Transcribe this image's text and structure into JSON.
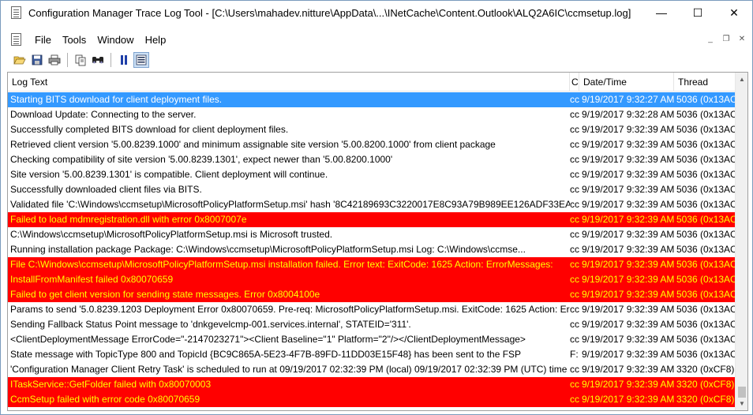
{
  "window": {
    "title": "Configuration Manager Trace Log Tool - [C:\\Users\\mahadev.nitture\\AppData\\...\\INetCache\\Content.Outlook\\ALQ2A6IC\\ccmsetup.log]",
    "minimize": "—",
    "maximize": "☐",
    "close": "✕"
  },
  "menu": {
    "items": [
      "File",
      "Tools",
      "Window",
      "Help"
    ],
    "mdi_minimize": "_",
    "mdi_restore": "❐",
    "mdi_close": "✕"
  },
  "toolbar": {
    "icons": [
      "open-folder-icon",
      "save-icon",
      "print-icon",
      "copy-icon",
      "find-icon",
      "pause-icon",
      "highlight-icon"
    ]
  },
  "columns": {
    "log_text": "Log Text",
    "component": "C",
    "date_time": "Date/Time",
    "thread": "Thread"
  },
  "colors": {
    "selected_bg": "#3399ff",
    "error_bg": "#ff0000",
    "error_text": "#ffff00"
  },
  "rows": [
    {
      "text": "Starting BITS download for client deployment files.",
      "comp": "cc",
      "date": "9/19/2017 9:32:27 AM",
      "thread": "5036 (0x13AC)",
      "type": "selected"
    },
    {
      "text": "Download Update: Connecting to the server.",
      "comp": "cc",
      "date": "9/19/2017 9:32:28 AM",
      "thread": "5036 (0x13AC)",
      "type": "normal"
    },
    {
      "text": "Successfully completed BITS download for client deployment files.",
      "comp": "cc",
      "date": "9/19/2017 9:32:39 AM",
      "thread": "5036 (0x13AC)",
      "type": "normal"
    },
    {
      "text": "Retrieved client version '5.00.8239.1000' and minimum assignable site version '5.00.8200.1000' from client package",
      "comp": "cc",
      "date": "9/19/2017 9:32:39 AM",
      "thread": "5036 (0x13AC)",
      "type": "normal"
    },
    {
      "text": "Checking compatibility of site version '5.00.8239.1301', expect newer than '5.00.8200.1000'",
      "comp": "cc",
      "date": "9/19/2017 9:32:39 AM",
      "thread": "5036 (0x13AC)",
      "type": "normal"
    },
    {
      "text": "Site version '5.00.8239.1301' is compatible. Client deployment will continue.",
      "comp": "cc",
      "date": "9/19/2017 9:32:39 AM",
      "thread": "5036 (0x13AC)",
      "type": "normal"
    },
    {
      "text": "Successfully downloaded client files via BITS.",
      "comp": "cc",
      "date": "9/19/2017 9:32:39 AM",
      "thread": "5036 (0x13AC)",
      "type": "normal"
    },
    {
      "text": "Validated file 'C:\\Windows\\ccmsetup\\MicrosoftPolicyPlatformSetup.msi' hash '8C42189693C3220017E8C93A79B989EE126ADF33EAD...",
      "comp": "cc",
      "date": "9/19/2017 9:32:39 AM",
      "thread": "5036 (0x13AC)",
      "type": "normal"
    },
    {
      "text": "Failed to load mdmregistration.dll with error 0x8007007e",
      "comp": "cc",
      "date": "9/19/2017 9:32:39 AM",
      "thread": "5036 (0x13AC)",
      "type": "error"
    },
    {
      "text": "C:\\Windows\\ccmsetup\\MicrosoftPolicyPlatformSetup.msi is Microsoft trusted.",
      "comp": "cc",
      "date": "9/19/2017 9:32:39 AM",
      "thread": "5036 (0x13AC)",
      "type": "normal"
    },
    {
      "text": "Running installation package   Package:     C:\\Windows\\ccmsetup\\MicrosoftPolicyPlatformSetup.msi   Log:        C:\\Windows\\ccmse...",
      "comp": "cc",
      "date": "9/19/2017 9:32:39 AM",
      "thread": "5036 (0x13AC)",
      "type": "normal"
    },
    {
      "text": "File C:\\Windows\\ccmsetup\\MicrosoftPolicyPlatformSetup.msi installation failed. Error text: ExitCode: 1625 Action: ErrorMessages:",
      "comp": "cc",
      "date": "9/19/2017 9:32:39 AM",
      "thread": "5036 (0x13AC)",
      "type": "error"
    },
    {
      "text": "InstallFromManifest failed 0x80070659",
      "comp": "cc",
      "date": "9/19/2017 9:32:39 AM",
      "thread": "5036 (0x13AC)",
      "type": "error"
    },
    {
      "text": "Failed to get client version for sending state messages. Error 0x8004100e",
      "comp": "cc",
      "date": "9/19/2017 9:32:39 AM",
      "thread": "5036 (0x13AC)",
      "type": "error"
    },
    {
      "text": "Params to send '5.0.8239.1203 Deployment Error 0x80070659. Pre-req: MicrosoftPolicyPlatformSetup.msi. ExitCode: 1625 Action:  Err...",
      "comp": "cc",
      "date": "9/19/2017 9:32:39 AM",
      "thread": "5036 (0x13AC)",
      "type": "normal"
    },
    {
      "text": "Sending Fallback Status Point message to 'dnkgevelcmp-001.services.internal', STATEID='311'.",
      "comp": "cc",
      "date": "9/19/2017 9:32:39 AM",
      "thread": "5036 (0x13AC)",
      "type": "normal"
    },
    {
      "text": "<ClientDeploymentMessage ErrorCode=\"-2147023271\"><Client Baseline=\"1\" Platform=\"2\"/></ClientDeploymentMessage>",
      "comp": "cc",
      "date": "9/19/2017 9:32:39 AM",
      "thread": "5036 (0x13AC)",
      "type": "normal"
    },
    {
      "text": "State message with TopicType 800 and TopicId {BC9C865A-5E23-4F7B-89FD-11DD03E15F48} has been sent to the FSP",
      "comp": "F:",
      "date": "9/19/2017 9:32:39 AM",
      "thread": "5036 (0x13AC)",
      "type": "normal"
    },
    {
      "text": "'Configuration Manager Client Retry Task' is scheduled to run at 09/19/2017 02:32:39 PM (local) 09/19/2017 02:32:39 PM (UTC) time ...",
      "comp": "cc",
      "date": "9/19/2017 9:32:39 AM",
      "thread": "3320 (0xCF8)",
      "type": "normal"
    },
    {
      "text": "ITaskService::GetFolder failed with 0x80070003",
      "comp": "cc",
      "date": "9/19/2017 9:32:39 AM",
      "thread": "3320 (0xCF8)",
      "type": "error"
    },
    {
      "text": "CcmSetup failed with error code 0x80070659",
      "comp": "cc",
      "date": "9/19/2017 9:32:39 AM",
      "thread": "3320 (0xCF8)",
      "type": "error"
    }
  ]
}
